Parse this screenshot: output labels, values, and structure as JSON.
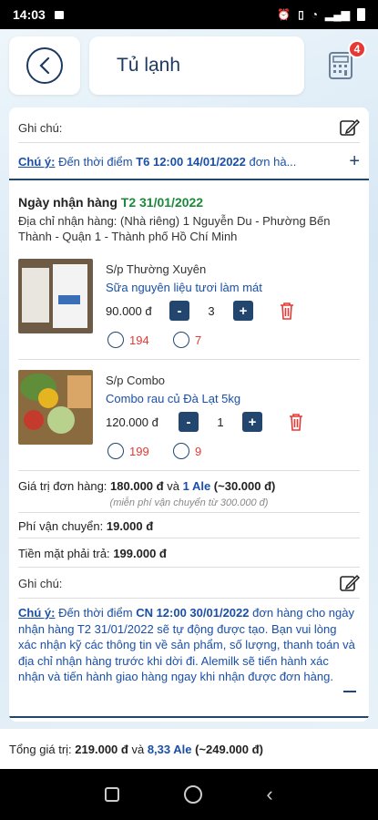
{
  "status_bar": {
    "time": "14:03"
  },
  "header": {
    "title": "Tủ lạnh",
    "cart_count": "4"
  },
  "note_top": {
    "label": "Ghi chú:"
  },
  "notice": {
    "prefix": "Chú ý:",
    "text_pre": " Đến thời điểm ",
    "datetime": "T6 12:00 14/01/2022",
    "text_post": " đơn hà..."
  },
  "delivery": {
    "label": "Ngày nhận hàng",
    "date": "T2 31/01/2022",
    "address_label": "Địa chỉ nhận hàng:",
    "address_type": "(Nhà riêng)",
    "address_line1": "1 Nguyễn Du - Phường Bến",
    "address_line2": "Thành - Quận 1 - Thành phố Hồ Chí Minh"
  },
  "products": [
    {
      "type": "S/p Thường Xuyên",
      "name": "Sữa nguyên liệu tươi làm mát",
      "price": "90.000 đ",
      "qty": "3",
      "stat_a": "194",
      "stat_b": "7"
    },
    {
      "type": "S/p Combo",
      "name": "Combo rau củ Đà Lạt 5kg",
      "price": "120.000 đ",
      "qty": "1",
      "stat_a": "199",
      "stat_b": "9"
    }
  ],
  "summary": {
    "order_value_label": "Giá trị đơn hàng:",
    "order_value": "180.000 đ",
    "and": "và",
    "ale": "1 Ale",
    "ale_equiv": "(~30.000 đ)",
    "free_ship": "(miễn phí vận chuyển từ 300.000 đ)",
    "ship_label": "Phí vận chuyển:",
    "ship_value": "19.000 đ",
    "cash_label": "Tiền mặt phải trả:",
    "cash_value": "199.000 đ"
  },
  "note_bottom": {
    "label": "Ghi chú:",
    "prefix": "Chú ý:",
    "text1": " Đến thời điểm ",
    "datetime": "CN 12:00 30/01/2022",
    "text2": " đơn hàng cho ngày nhận hàng T2 31/01/2022 sẽ tự động được tạo. Bạn vui lòng xác nhận kỹ các thông tin về sản phẩm, số lượng, thanh toán và địa chỉ nhận hàng trước khi dời đi. Alemilk sẽ tiến hành xác nhận và  tiến hành giao hàng ngay khi nhận được đơn hàng."
  },
  "total": {
    "label": "Tổng giá trị:",
    "value": "219.000 đ",
    "and": "và",
    "ale": "8,33 Ale",
    "equiv": "(~249.000 đ)"
  },
  "colors": {
    "navy": "#23466f",
    "blue_text": "#1a4fa8",
    "green": "#1b8a3a",
    "red": "#e53935"
  }
}
